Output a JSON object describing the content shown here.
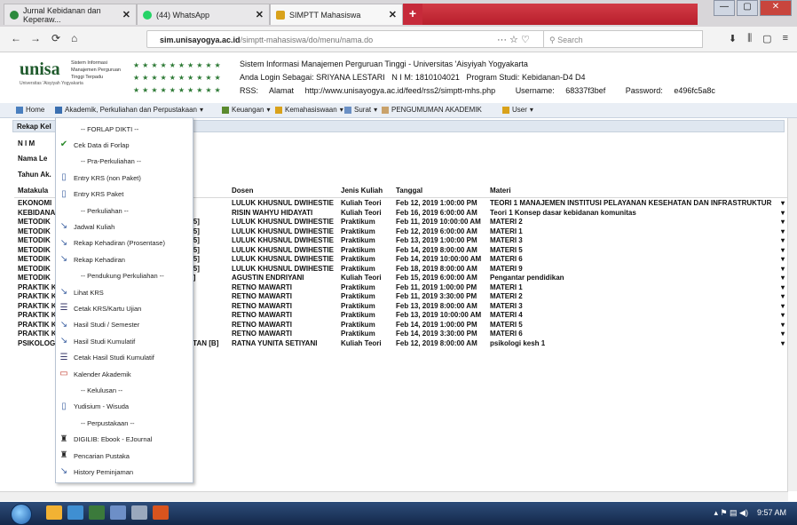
{
  "browser": {
    "tabs": [
      {
        "label": "Jurnal Kebidanan dan Keperaw...",
        "color": "#2c8a3c"
      },
      {
        "label": "(44) WhatsApp",
        "color": "#25d366"
      },
      {
        "label": "SIMPTT Mahasiswa",
        "color": "#d9a21b"
      }
    ],
    "new_tab": "+",
    "window_controls": {
      "minimize": "—",
      "maximize": "▢",
      "close": "✕"
    },
    "url_domain": "sim.unisayogya.ac.id",
    "url_path": "/simptt-mahasiswa/do/menu/nama.do",
    "search_placeholder": "Search",
    "url_icons": "··· ☆ ♡",
    "right_icons": [
      "⬇",
      "⫼",
      "▢",
      "≡"
    ]
  },
  "header": {
    "logo": "unisa",
    "logo_sub": "Universitas 'Aisyiyah Yogyakarta",
    "system_name": "Sistem Informasi Manajemen Perguruan Tinggi Terpadu",
    "line1": "Sistem Informasi Manajemen Perguruan Tinggi - Universitas 'Aisyiyah Yogyakarta",
    "login_label": "Anda Login Sebagai:",
    "login_name": "SRIYANA LESTARI",
    "nim_label": "N I M:",
    "nim": "1810104021",
    "prodi_label": "Program Studi:",
    "prodi": "Kebidanan-D4 D4",
    "rss_label": "RSS:",
    "alamat_label": "Alamat",
    "rss_url": "http://www.unisayogya.ac.id/feed/rss2/simptt-mhs.php",
    "username_label": "Username:",
    "username": "68337f3bef",
    "password_label": "Password:",
    "password": "e496fc5a8c"
  },
  "menubar": {
    "items": [
      {
        "label": "Home",
        "color": "#4a7fbf"
      },
      {
        "label": "Akademik, Perkuliahan dan Perpustakaan",
        "color": "#3a6fb0"
      },
      {
        "label": "Keuangan",
        "color": "#5a8a2e"
      },
      {
        "label": "Kemahasiswaan",
        "color": "#d9a21b"
      },
      {
        "label": "Surat",
        "color": "#6a8fc4"
      },
      {
        "label": "PENGUMUMAN AKADEMIK",
        "color": "#c9a26b"
      },
      {
        "label": "User",
        "color": "#d9a21b"
      }
    ]
  },
  "page": {
    "rekap_title": "Rekap Kel",
    "nim_label": "N I M",
    "nama_label": "Nama Le",
    "tahun_label": "Tahun Ak."
  },
  "table": {
    "headers": {
      "matakuliah": "Matakula",
      "dosen": "Dosen",
      "jenis": "Jenis Kuliah",
      "tanggal": "Tanggal",
      "materi": "Materi"
    },
    "rows": [
      {
        "mk": "EKONOMI",
        "cls": "",
        "dosen": "LULUK KHUSNUL DWIHESTIE",
        "jenis": "Kuliah Teori",
        "tanggal": "Feb 12, 2019 1:00:00 PM",
        "materi": "TEORI 1 MANAJEMEN INSTITUSI PELAYANAN KESEHATAN DAN INFRASTRUKTUR"
      },
      {
        "mk": "KEBIDANA",
        "cls": "",
        "dosen": "RISIN WAHYU HIDAYATI",
        "jenis": "Kuliah Teori",
        "tanggal": "Feb 16, 2019 6:00:00 AM",
        "materi": "Teori 1 Konsep dasar kebidanan komunitas"
      },
      {
        "mk": "METODIK",
        "cls": "B5]",
        "dosen": "LULUK KHUSNUL DWIHESTIE",
        "jenis": "Praktikum",
        "tanggal": "Feb 11, 2019 10:00:00 AM",
        "materi": "MATERI 2"
      },
      {
        "mk": "METODIK",
        "cls": "B5]",
        "dosen": "LULUK KHUSNUL DWIHESTIE",
        "jenis": "Praktikum",
        "tanggal": "Feb 12, 2019 6:00:00 AM",
        "materi": "MATERI 1"
      },
      {
        "mk": "METODIK",
        "cls": "B5]",
        "dosen": "LULUK KHUSNUL DWIHESTIE",
        "jenis": "Praktikum",
        "tanggal": "Feb 13, 2019 1:00:00 PM",
        "materi": "MATERI 3"
      },
      {
        "mk": "METODIK",
        "cls": "B5]",
        "dosen": "LULUK KHUSNUL DWIHESTIE",
        "jenis": "Praktikum",
        "tanggal": "Feb 14, 2019 8:00:00 AM",
        "materi": "MATERI 5"
      },
      {
        "mk": "METODIK",
        "cls": "B5]",
        "dosen": "LULUK KHUSNUL DWIHESTIE",
        "jenis": "Praktikum",
        "tanggal": "Feb 14, 2019 10:00:00 AM",
        "materi": "MATERI 6"
      },
      {
        "mk": "METODIK",
        "cls": "B5]",
        "dosen": "LULUK KHUSNUL DWIHESTIE",
        "jenis": "Praktikum",
        "tanggal": "Feb 18, 2019 8:00:00 AM",
        "materi": "MATERI 9"
      },
      {
        "mk": "METODIK",
        "cls": "B]",
        "dosen": "AGUSTIN ENDRIYANI",
        "jenis": "Kuliah Teori",
        "tanggal": "Feb 15, 2019 6:00:00 AM",
        "materi": "Pengantar pendidikan"
      },
      {
        "mk": "PRAKTIK K",
        "cls": "",
        "dosen": "RETNO MAWARTI",
        "jenis": "Praktikum",
        "tanggal": "Feb 11, 2019 1:00:00 PM",
        "materi": "MATERI 1"
      },
      {
        "mk": "PRAKTIK K",
        "cls": "",
        "dosen": "RETNO MAWARTI",
        "jenis": "Praktikum",
        "tanggal": "Feb 11, 2019 3:30:00 PM",
        "materi": "MATERI 2"
      },
      {
        "mk": "PRAKTIK K",
        "cls": "",
        "dosen": "RETNO MAWARTI",
        "jenis": "Praktikum",
        "tanggal": "Feb 13, 2019 8:00:00 AM",
        "materi": "MATERI 3"
      },
      {
        "mk": "PRAKTIK K",
        "cls": "",
        "dosen": "RETNO MAWARTI",
        "jenis": "Praktikum",
        "tanggal": "Feb 13, 2019 10:00:00 AM",
        "materi": "MATERI 4"
      },
      {
        "mk": "PRAKTIK K",
        "cls": "",
        "dosen": "RETNO MAWARTI",
        "jenis": "Praktikum",
        "tanggal": "Feb 14, 2019 1:00:00 PM",
        "materi": "MATERI 5"
      },
      {
        "mk": "PRAKTIK K",
        "cls": "",
        "dosen": "RETNO MAWARTI",
        "jenis": "Praktikum",
        "tanggal": "Feb 14, 2019 3:30:00 PM",
        "materi": "MATERI 6"
      },
      {
        "mk": "PSIKOLOG",
        "cls": "ATAN [B]",
        "dosen": "RATNA YUNITA SETIYANI",
        "jenis": "Kuliah Teori",
        "tanggal": "Feb 12, 2019 8:00:00 AM",
        "materi": "psikologi kesh 1"
      }
    ],
    "row_arrow": "▾"
  },
  "dropdown": {
    "items": [
      {
        "label": "-- FORLAP DIKTI --",
        "icon": "",
        "name": "section-forlap"
      },
      {
        "label": "Cek Data di Forlap",
        "icon": "✔",
        "name": "cek-data-forlap"
      },
      {
        "label": "-- Pra-Perkuliahan --",
        "icon": "",
        "name": "section-pra-perkuliahan"
      },
      {
        "label": "Entry KRS (non Paket)",
        "icon": "▯",
        "name": "entry-krs-non-paket"
      },
      {
        "label": "Entry KRS Paket",
        "icon": "▯",
        "name": "entry-krs-paket"
      },
      {
        "label": "-- Perkuliahan --",
        "icon": "",
        "name": "section-perkuliahan"
      },
      {
        "label": "Jadwal Kuliah",
        "icon": "↘",
        "name": "jadwal-kuliah"
      },
      {
        "label": "Rekap Kehadiran (Prosentase)",
        "icon": "↘",
        "name": "rekap-kehadiran-prosentase"
      },
      {
        "label": "Rekap Kehadiran",
        "icon": "↘",
        "name": "rekap-kehadiran"
      },
      {
        "label": "-- Pendukung Perkuliahan --",
        "icon": "",
        "name": "section-pendukung"
      },
      {
        "label": "Lihat KRS",
        "icon": "↘",
        "name": "lihat-krs"
      },
      {
        "label": "Cetak KRS/Kartu Ujian",
        "icon": "☰",
        "name": "cetak-krs"
      },
      {
        "label": "Hasil Studi / Semester",
        "icon": "↘",
        "name": "hasil-studi-semester"
      },
      {
        "label": "Hasil Studi Kumulatif",
        "icon": "↘",
        "name": "hasil-studi-kumulatif"
      },
      {
        "label": "Cetak Hasil Studi Kumulatif",
        "icon": "☰",
        "name": "cetak-hasil-studi"
      },
      {
        "label": "Kalender Akademik",
        "icon": "▭",
        "name": "kalender-akademik"
      },
      {
        "label": "-- Kelulusan --",
        "icon": "",
        "name": "section-kelulusan"
      },
      {
        "label": "Yudisium - Wisuda",
        "icon": "▯",
        "name": "yudisium-wisuda"
      },
      {
        "label": "-- Perpustakaan --",
        "icon": "",
        "name": "section-perpustakaan"
      },
      {
        "label": "DIGILIB: Ebook - EJournal",
        "icon": "♜",
        "name": "digilib"
      },
      {
        "label": "Pencarian Pustaka",
        "icon": "♜",
        "name": "pencarian-pustaka"
      },
      {
        "label": "History Peminjaman",
        "icon": "↘",
        "name": "history-peminjaman"
      }
    ]
  },
  "taskbar": {
    "clock": "9:57 AM",
    "tray_icons": "▴ ⚑ ▤ ◀)"
  }
}
